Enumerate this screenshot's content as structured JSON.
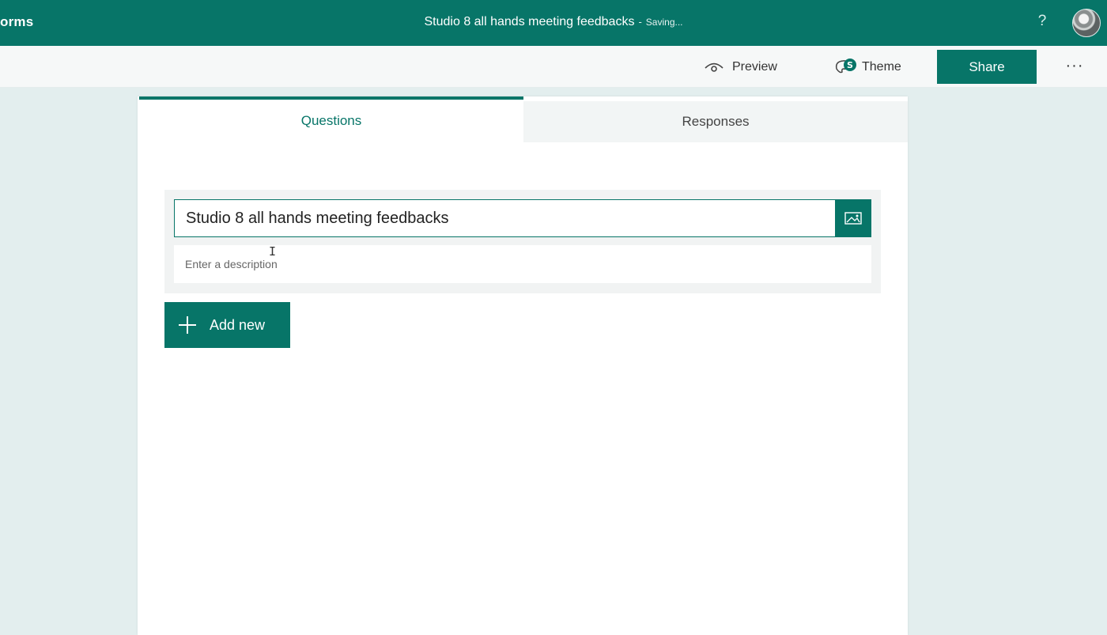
{
  "app": {
    "name": "orms",
    "form_title": "Studio 8 all hands meeting feedbacks",
    "separator": "-",
    "save_status": "Saving...",
    "help_label": "?",
    "brand_color": "#077568"
  },
  "toolbar": {
    "preview_label": "Preview",
    "theme_label": "Theme",
    "share_label": "Share",
    "more_label": "···"
  },
  "tabs": [
    {
      "label": "Questions",
      "active": true
    },
    {
      "label": "Responses",
      "active": false
    }
  ],
  "form": {
    "title_value": "Studio 8 all hands meeting feedbacks",
    "description_placeholder": "Enter a description",
    "add_new_label": "Add new"
  },
  "icons": {
    "preview": "eye-icon",
    "theme": "palette-icon",
    "image": "image-icon",
    "add": "plus-icon",
    "avatar": "user-avatar"
  }
}
